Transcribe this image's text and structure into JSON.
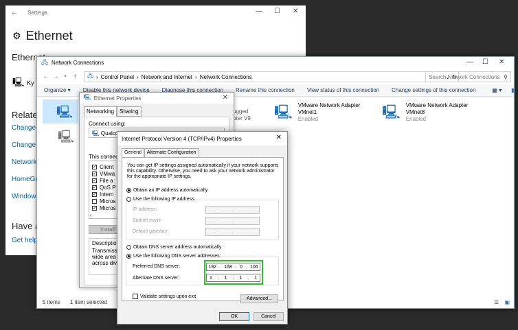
{
  "settings": {
    "title": "Settings",
    "heading": "Ethernet",
    "subheading": "Ethernet",
    "network_name_partial": "Ky",
    "related": "Related",
    "links": [
      "Change a",
      "Change a",
      "Network",
      "HomeGro",
      "Windows"
    ],
    "have_a": "Have a",
    "get_help": "Get help"
  },
  "netconn": {
    "title": "Network Connections",
    "breadcrumb": [
      "Control Panel",
      "Network and Internet",
      "Network Connections"
    ],
    "search_placeholder": "Search Network Connections",
    "commands": [
      "Organize ▾",
      "Disable this network device",
      "Diagnose this connection",
      "Rename this connection",
      "View status of this connection",
      "Change settings of this connection"
    ],
    "adapters": [
      {
        "name": "VMware Network Adapter",
        "sub": "VMnet1",
        "status": "Enabled"
      },
      {
        "name": "VMware Network Adapter",
        "sub": "VMnet8",
        "status": "Enabled"
      }
    ],
    "partial_texts": [
      "ugged",
      "pter V9"
    ],
    "status_items": "5 items",
    "status_selected": "1 item selected"
  },
  "ethprops": {
    "title": "Ethernet Properties",
    "tabs": [
      "Networking",
      "Sharing"
    ],
    "connect_using": "Connect using:",
    "device_partial": "Qualcom",
    "this_connection": "This connecti",
    "items": [
      "Client",
      "VMwa",
      "File a",
      "QoS P",
      "Intern",
      "Micros",
      "Micros"
    ],
    "install": "Install",
    "description": "Description",
    "desc_text": [
      "Transmission",
      "wide area ne",
      "across diver"
    ]
  },
  "ipv4": {
    "title": "Internet Protocol Version 4 (TCP/IPv4) Properties",
    "tabs": [
      "General",
      "Alternate Configuration"
    ],
    "info": "You can get IP settings assigned automatically if your network supports this capability. Otherwise, you need to ask your network administrator for the appropriate IP settings.",
    "obtain_ip_auto": "Obtain an IP address automatically",
    "use_ip": "Use the following IP address:",
    "ip_address": "IP address:",
    "subnet_mask": "Subnet mask:",
    "default_gateway": "Default gateway:",
    "obtain_dns_auto": "Obtain DNS server address automatically",
    "use_dns": "Use the following DNS server addresses:",
    "preferred_dns": "Preferred DNS server:",
    "alternate_dns": "Alternate DNS server:",
    "preferred_dns_octets": [
      "192",
      "168",
      "0",
      "106"
    ],
    "alternate_dns_octets": [
      "1",
      "1",
      "1",
      "1"
    ],
    "validate": "Validate settings upon exit",
    "advanced": "Advanced...",
    "ok": "OK",
    "cancel": "Cancel"
  },
  "colors": {
    "link": "#0063b1",
    "highlight": "#1ecb1e",
    "accent": "#0078d7"
  }
}
